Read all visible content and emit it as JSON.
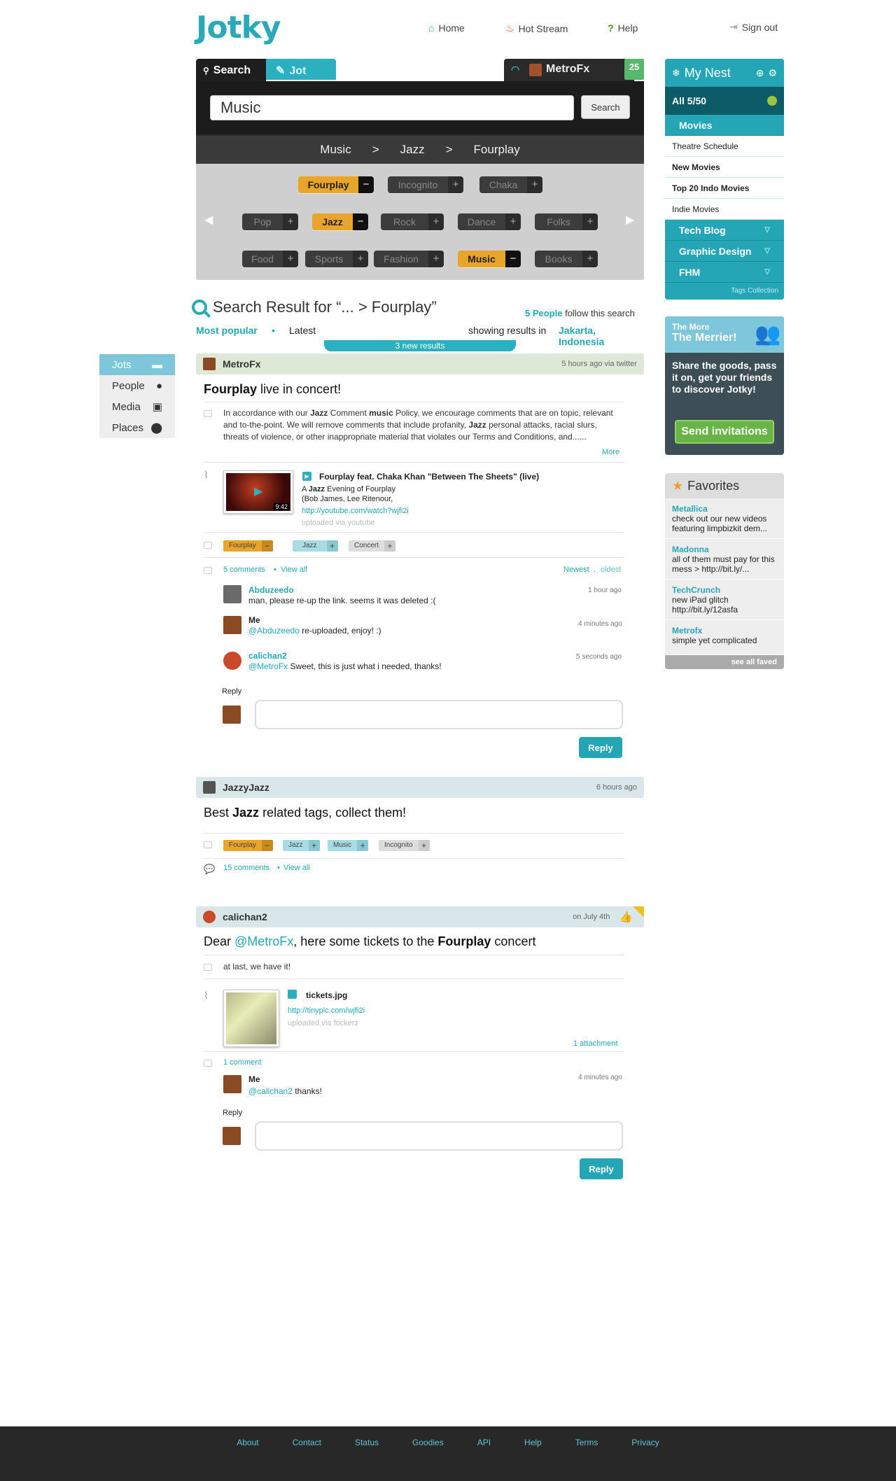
{
  "app": {
    "logo": "Jotky"
  },
  "nav": {
    "home": "Home",
    "hot_stream": "Hot Stream",
    "help": "Help",
    "sign_out": "Sign out"
  },
  "panel": {
    "tab_search": "Search",
    "tab_jot": "Jot",
    "user_tab": "MetroFx",
    "badge": "25",
    "search_value": "Music",
    "search_button": "Search",
    "breadcrumbs": [
      "Music",
      ">",
      "Jazz",
      ">",
      "Fourplay"
    ],
    "tags_row1": [
      "Fourplay",
      "Incognito",
      "Chaka"
    ],
    "tags_row2": [
      "Pop",
      "Jazz",
      "Rock",
      "Dance",
      "Folks"
    ],
    "tags_row3": [
      "Food",
      "Sports",
      "Fashion",
      "Music",
      "Books"
    ]
  },
  "results": {
    "title": "Search Result for “... > Fourplay”",
    "people_count": "5 People",
    "people_suffix": "follow this search",
    "sort_popular": "Most popular",
    "sort_latest": "Latest",
    "showing_in": "showing results in",
    "location": "Jakarta, Indonesia",
    "new_results": "3 new results"
  },
  "filters": [
    "Jots",
    "People",
    "Media",
    "Places"
  ],
  "post1": {
    "user": "MetroFx",
    "time": "5 hours ago  via twitter",
    "title_bold": "Fourplay",
    "title_rest": " live in concert!",
    "body_1": "In accordance with our ",
    "body_jazz": "Jazz",
    "body_2": " Comment ",
    "body_music": "music",
    "body_3": " Policy, we encourage comments that are on topic, relevant and to-the-point. We will remove comments that include profanity, ",
    "body_jazz2": "Jazz",
    "body_4": " personal attacks, racial slurs, threats of violence, or other inappropriate material that violates our Terms and Conditions, and......",
    "more": "More",
    "video_title": "Fourplay feat. Chaka Khan \"Between The Sheets\" (live)",
    "video_desc_a": "A ",
    "video_desc_b": "Jazz",
    "video_desc_c": " Evening of Fourplay",
    "video_desc_2": "(Bob James, Lee Ritenour,",
    "video_link": "http://youtube.com/watch?wjfi2i",
    "video_source": "uploaded via youtube",
    "video_duration": "9:42",
    "tags": [
      "Fourplay",
      "Jazz",
      "Concert"
    ],
    "comments_count": "5 comments",
    "view_all": "View all",
    "sort_newest": "Newest",
    "sort_oldest": "oldest",
    "comments": [
      {
        "name": "Abduzeedo",
        "text": "man, please re-up the link. seems it was deleted :(",
        "time": "1 hour ago"
      },
      {
        "name": "Me",
        "mention": "@Abduzeedo",
        "text": " re-uploaded, enjoy! :)",
        "time": "4 minutes ago"
      },
      {
        "name": "calichan2",
        "mention": "@MetroFx",
        "text": " Sweet, this is just what i needed, thanks!",
        "time": "5 seconds ago"
      }
    ],
    "reply_label": "Reply",
    "reply_button": "Reply"
  },
  "post2": {
    "user": "JazzyJazz",
    "time": "6 hours ago",
    "title_1": "Best ",
    "title_bold": "Jazz",
    "title_2": " related tags, collect them!",
    "tags": [
      "Fourplay",
      "Jazz",
      "Music",
      "Incognito"
    ],
    "comments_count": "15 comments",
    "view_all": "View all"
  },
  "post3": {
    "user": "calichan2",
    "time": "on July 4th",
    "title_1": "Dear ",
    "title_mention": "@MetroFx",
    "title_2": ", here some tickets to the ",
    "title_bold": "Fourplay",
    "title_3": " concert",
    "body": "at last, we have it!",
    "file_name": "tickets.jpg",
    "file_link": "http://tinypic.com/wjfi2i",
    "file_source": "uploaded via fockerz",
    "attachments": "1 attachment",
    "comments_count": "1 comment",
    "comment": {
      "name": "Me",
      "mention": "@calichan2",
      "text": " thanks!",
      "time": "4 minutes ago"
    },
    "reply_label": "Reply",
    "reply_button": "Reply"
  },
  "nest": {
    "title": "My Nest",
    "all": "All  5/50",
    "sections": [
      {
        "label": "Movies",
        "items": [
          "Theatre Schedule",
          "New Movies",
          "Top 20 Indo Movies",
          "Indie Movies"
        ]
      },
      {
        "label": "Tech Blog"
      },
      {
        "label": "Graphic Design"
      },
      {
        "label": "FHM"
      }
    ],
    "footer": "Tags Collection"
  },
  "invite": {
    "line1": "The More",
    "line2": "The Merrier!",
    "body": "Share the goods, pass it on, get your friends to discover Jotky!",
    "button": "Send invitations"
  },
  "favorites": {
    "title": "Favorites",
    "items": [
      {
        "name": "Metallica",
        "text": "check out our new videos featuring limpbizkit dem..."
      },
      {
        "name": "Madonna",
        "text": "all of them must pay for this mess > http://bit.ly/..."
      },
      {
        "name": "TechCrunch",
        "text": "new iPad glitch http://bit.ly/12asfa"
      },
      {
        "name": "Metrofx",
        "text": "simple yet complicated"
      }
    ],
    "see_all": "see all faved"
  },
  "footer": [
    "About",
    "Contact",
    "Status",
    "Goodies",
    "API",
    "Help",
    "Terms",
    "Privacy"
  ],
  "colors": {
    "accent": "#24a6b6",
    "tag_active": "#e9a52a",
    "invite_green": "#69b446"
  },
  "icons": [
    "home-icon",
    "fire-icon",
    "question-icon",
    "sign-out-icon",
    "search-icon",
    "pencil-icon",
    "rss-icon",
    "settings-icon",
    "plus-icon",
    "star-icon",
    "comment-icon",
    "person-icon",
    "media-icon",
    "place-icon",
    "thumbs-up-icon",
    "paperclip-icon"
  ]
}
